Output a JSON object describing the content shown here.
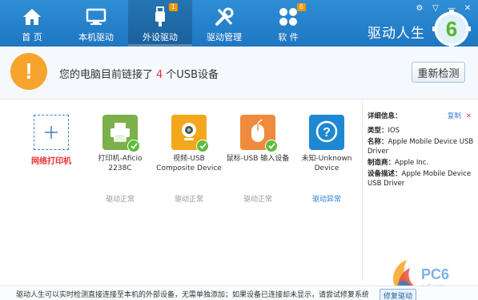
{
  "nav": [
    {
      "label": "首 页",
      "icon": "home-icon"
    },
    {
      "label": "本机驱动",
      "icon": "monitor-icon"
    },
    {
      "label": "外设驱动",
      "icon": "usb-icon",
      "badge": "1",
      "active": true
    },
    {
      "label": "驱动管理",
      "icon": "wrench-icon"
    },
    {
      "label": "软 件",
      "icon": "apps-icon",
      "badge": "6"
    }
  ],
  "brand": {
    "name": "驱动人生",
    "logo_text": "6"
  },
  "status": {
    "prefix": "您的电脑目前链接了",
    "count": "4",
    "suffix": "个USB设备",
    "rescan_label": "重新检测"
  },
  "devices": [
    {
      "kind": "add",
      "label": "网络打印机"
    },
    {
      "name": "打印机-Aficio 2238C",
      "status": "驱动正常",
      "icon": "printer-icon",
      "color": "#7bb04a"
    },
    {
      "name": "视频-USB Composite Device",
      "status": "驱动正常",
      "icon": "webcam-icon",
      "color": "#f2a71c"
    },
    {
      "name": "鼠标-USB 输入设备",
      "status": "驱动正常",
      "icon": "mouse-icon",
      "color": "#f08a3c"
    },
    {
      "name": "未知-Unknown Device",
      "status": "驱动异常",
      "icon": "question-icon",
      "color": "#1e88d2",
      "error": true
    }
  ],
  "details": {
    "title": "详细信息：",
    "copy": "复制",
    "type_label": "类型：",
    "type_value": "IOS",
    "name_label": "名称：",
    "name_value": "Apple Mobile Device USB Driver",
    "vendor_label": "制造商：",
    "vendor_value": "Apple Inc.",
    "desc_label": "设备描述：",
    "desc_value": "Apple Mobile Device USB Driver"
  },
  "footer": {
    "text": "驱动人生可以实时检测直接连接至本机的外部设备，无需单独添加；如果设备已连接却未显示，请尝试修复系统驱动",
    "repair_label": "修复驱动"
  },
  "watermark": {
    "text": "PC6",
    "sub": "pc6.com"
  }
}
